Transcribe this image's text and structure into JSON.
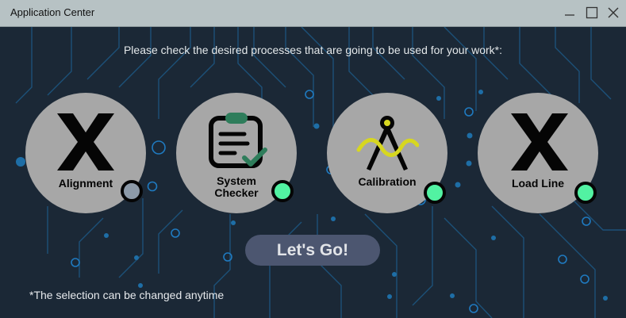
{
  "window": {
    "title": "Application Center"
  },
  "instructions": "Please check the desired processes that are going to be used for your work*:",
  "processes": [
    {
      "label": "Alignment",
      "icon": "x-mark-icon",
      "selected": false
    },
    {
      "label_line1": "System",
      "label_line2": "Checker",
      "icon": "clipboard-check-icon",
      "selected": true
    },
    {
      "label": "Calibration",
      "icon": "compass-wave-icon",
      "selected": true
    },
    {
      "label": "Load Line",
      "icon": "x-mark-icon",
      "selected": true
    }
  ],
  "go_button": "Let's Go!",
  "footnote": "*The selection can be changed anytime",
  "colors": {
    "background": "#1b2836",
    "titlebar": "#b7c2c4",
    "circle": "#a7a7a7",
    "checked": "#52f2a2",
    "unchecked": "#8d9aa8",
    "button": "#4c5670",
    "circuit": "#1e6ea6"
  }
}
